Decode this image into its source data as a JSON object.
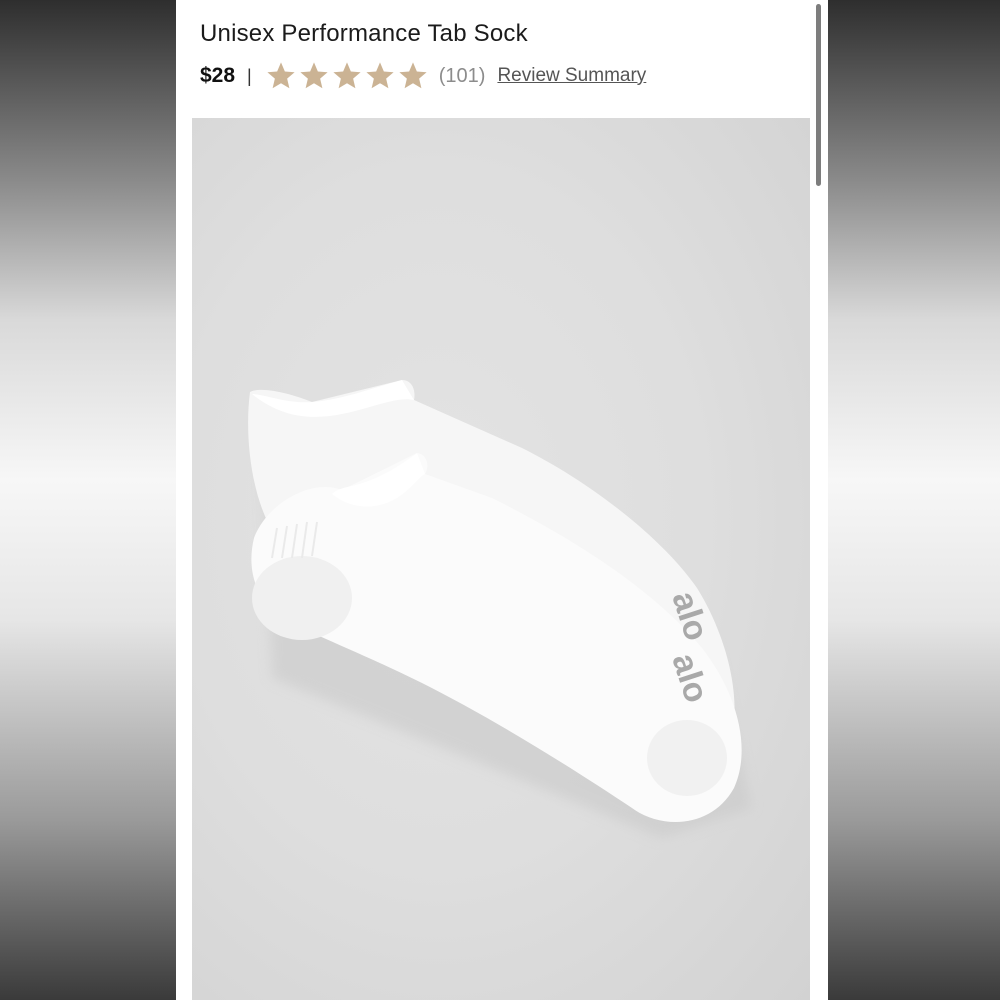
{
  "product": {
    "title": "Unisex Performance Tab Sock",
    "price": "$28",
    "separator": "|",
    "rating": {
      "value": 5,
      "max": 5,
      "count_text": "(101)"
    },
    "review_link": "Review Summary",
    "image": {
      "subject": "white-ankle-tab-socks",
      "logo_text": "alo"
    }
  },
  "colors": {
    "star": "#cbb394",
    "panel_bg": "#ffffff",
    "image_bg": "#dedede",
    "scrollbar": "#7d7d7d"
  }
}
